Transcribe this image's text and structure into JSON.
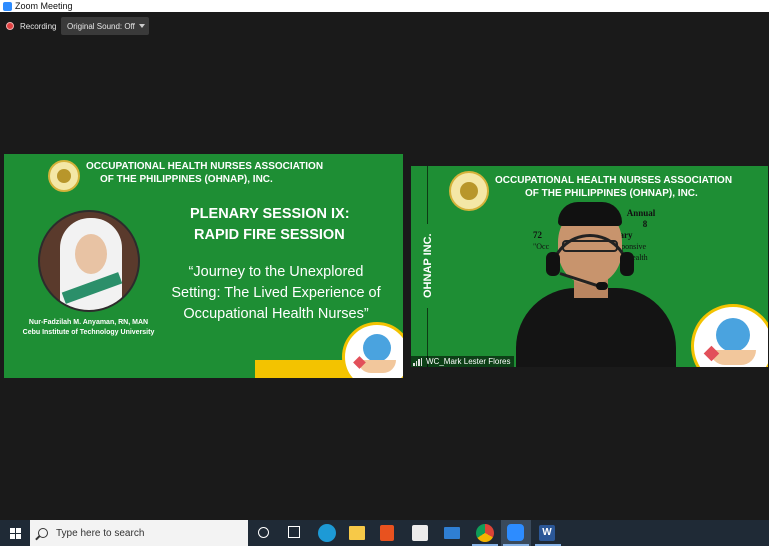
{
  "window": {
    "title": "Zoom Meeting"
  },
  "toolbar": {
    "recording_label": "Recording",
    "original_sound_label": "Original Sound: Off"
  },
  "left_slide": {
    "org_line1": "OCCUPATIONAL HEALTH NURSES ASSOCIATION",
    "org_line2": "OF THE PHILIPPINES (OHNAP), INC.",
    "session_line1": "PLENARY SESSION IX:",
    "session_line2": "RAPID FIRE SESSION",
    "quote_line1": "“Journey to the Unexplored",
    "quote_line2": "Setting: The Lived Experience of",
    "quote_line3": "Occupational Health Nurses”",
    "speaker_name": "Nur-Fadzilah M. Anyaman, RN, MAN",
    "speaker_affiliation": "Cebu Institute of Technology University"
  },
  "right_video": {
    "org_line1": "OCCUPATIONAL HEALTH NURSES ASSOCIATION",
    "org_line2": "OF THE PHILIPPINES (OHNAP), INC.",
    "vertical_label": "OHNAP INC.",
    "poster_line1": "Annual",
    "poster_line2": "8",
    "poster_line3": "72",
    "poster_line4": "niversary",
    "poster_line5": "\"Occ",
    "poster_line6": "Responsive",
    "poster_line7": "Health",
    "participant_name": "WC_Mark Lester Flores"
  },
  "taskbar": {
    "search_placeholder": "Type here to search",
    "word_glyph": "W"
  },
  "icons": {
    "start": "windows-logo-icon",
    "search": "search-icon",
    "cortana": "cortana-icon",
    "task_view": "task-view-icon",
    "edge": "edge-icon",
    "explorer": "file-explorer-icon",
    "office": "office-icon",
    "store": "store-icon",
    "mail": "mail-icon",
    "chrome": "chrome-icon",
    "zoom": "zoom-icon",
    "word": "word-icon"
  },
  "colors": {
    "slide_green": "#1e8e34",
    "accent_yellow": "#f3c300",
    "taskbar": "#1f2a36",
    "zoom_blue": "#2d8cff"
  }
}
